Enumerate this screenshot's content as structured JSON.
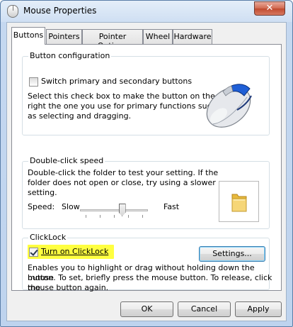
{
  "window": {
    "title": "Mouse Properties",
    "close_glyph": "✕"
  },
  "tabs": [
    {
      "label": "Buttons",
      "active": true
    },
    {
      "label": "Pointers"
    },
    {
      "label": "Pointer Options"
    },
    {
      "label": "Wheel"
    },
    {
      "label": "Hardware"
    }
  ],
  "button_config": {
    "legend": "Button configuration",
    "switch_label": "Switch primary and secondary buttons",
    "switch_checked": false,
    "description": [
      "Select this check box to make the button on the",
      "right the one you use for primary functions such",
      "as selecting and dragging."
    ]
  },
  "double_click": {
    "legend": "Double-click speed",
    "description": [
      "Double-click the folder to test your setting. If the",
      "folder does not open or close, try using a slower",
      "setting."
    ],
    "speed_label": "Speed:",
    "slow_label": "Slow",
    "fast_label": "Fast",
    "speed_level": 0.6
  },
  "clicklock": {
    "legend": "ClickLock",
    "toggle_label": "Turn on ClickLock",
    "toggle_checked": true,
    "settings_label": "Settings...",
    "description": [
      "Enables you to highlight or drag without holding down the mouse",
      "button. To set, briefly press the mouse button. To release, click the",
      "mouse button again."
    ]
  },
  "footer": {
    "ok_label": "OK",
    "cancel_label": "Cancel",
    "apply_label": "Apply"
  },
  "icons": {
    "window": "mouse-icon",
    "preview": "mouse-illustration",
    "test_folder": "folder-icon"
  },
  "colors": {
    "highlight": "#ffff40",
    "accent_blue": "#1f5fd6"
  }
}
